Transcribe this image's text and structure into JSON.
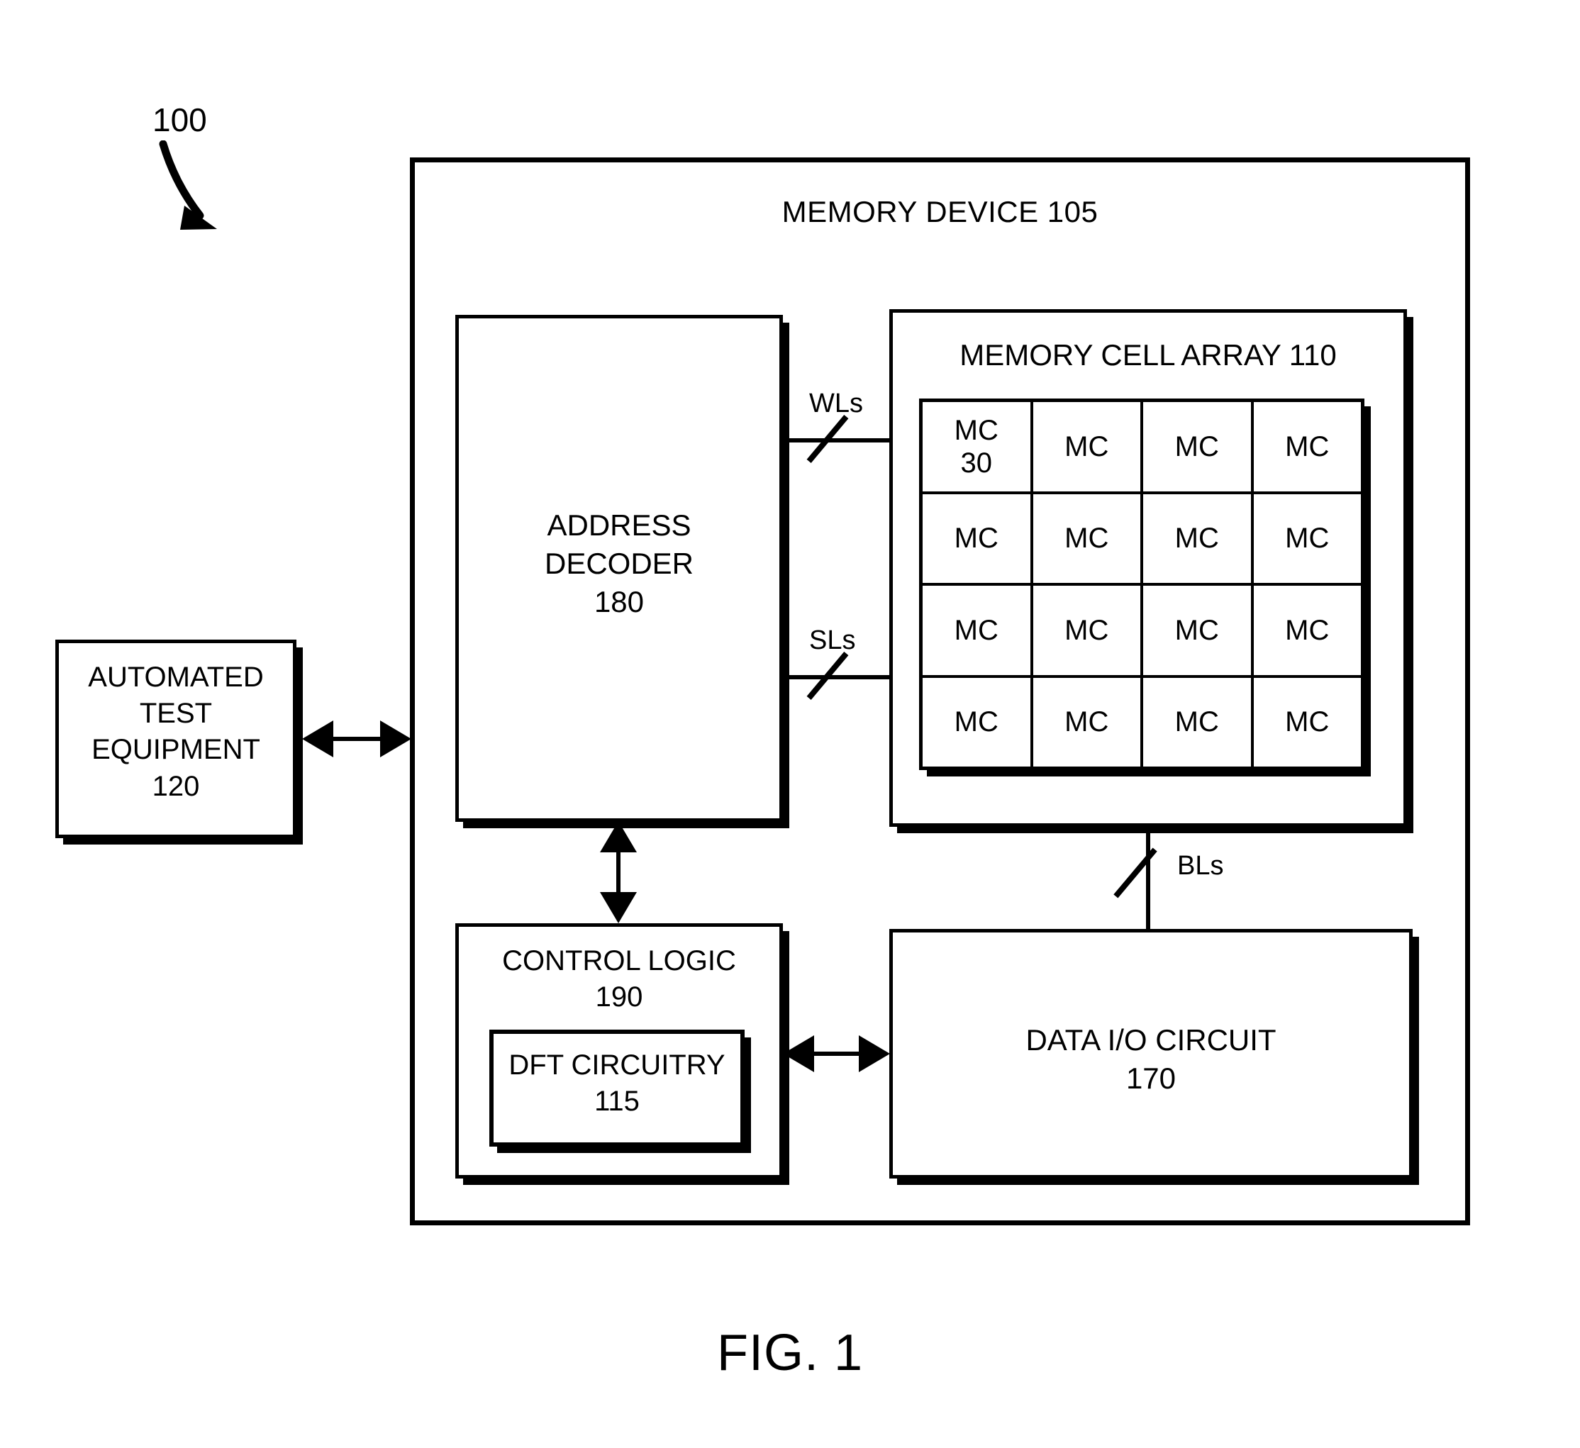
{
  "figure": {
    "caption": "FIG. 1",
    "reference_numeral": "100"
  },
  "memory_device": {
    "title": "MEMORY DEVICE 105"
  },
  "address_decoder": {
    "label": "ADDRESS\nDECODER\n180"
  },
  "memory_cell_array": {
    "title": "MEMORY CELL ARRAY 110",
    "rows": 4,
    "columns": 4,
    "cells": [
      [
        "MC\n30",
        "MC",
        "MC",
        "MC"
      ],
      [
        "MC",
        "MC",
        "MC",
        "MC"
      ],
      [
        "MC",
        "MC",
        "MC",
        "MC"
      ],
      [
        "MC",
        "MC",
        "MC",
        "MC"
      ]
    ]
  },
  "control_logic": {
    "label": "CONTROL LOGIC\n190",
    "dft_circuitry": {
      "label": "DFT CIRCUITRY\n115"
    }
  },
  "data_io_circuit": {
    "label": "DATA I/O CIRCUIT\n170"
  },
  "automated_test_equipment": {
    "label": "AUTOMATED\nTEST\nEQUIPMENT\n120"
  },
  "buses": {
    "word_lines": "WLs",
    "source_lines": "SLs",
    "bit_lines": "BLs"
  },
  "colors": {
    "ink": "#000000",
    "background": "#ffffff"
  }
}
